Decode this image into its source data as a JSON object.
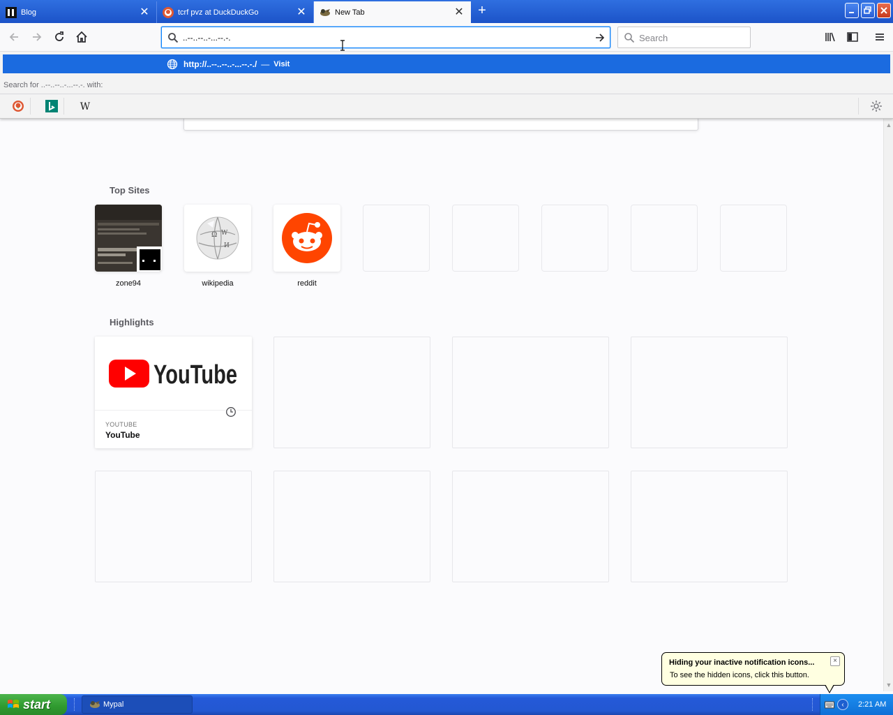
{
  "tabs": [
    {
      "label": "Blog",
      "favicon": "blog-favicon",
      "active": false
    },
    {
      "label": "tcrf pvz at DuckDuckGo",
      "favicon": "duckduckgo-favicon",
      "active": false
    },
    {
      "label": "New Tab",
      "favicon": "mypal-favicon",
      "active": true
    }
  ],
  "urlbar": {
    "value": "..--..--..-...--.-."
  },
  "searchbar": {
    "placeholder": "Search"
  },
  "dropdown": {
    "suggestion_url": "http://..--..--..-...--.-./",
    "suggestion_dash": "—",
    "suggestion_action": "Visit",
    "search_for": "Search for ..--..--..-...--.-. with:",
    "engines": [
      "duckduckgo-icon",
      "bing-icon",
      "wikipedia-w-icon"
    ]
  },
  "top_sites": {
    "title": "Top Sites",
    "sites": [
      {
        "label": "zone94"
      },
      {
        "label": "wikipedia"
      },
      {
        "label": "reddit"
      }
    ]
  },
  "highlights": {
    "title": "Highlights",
    "card": {
      "host": "YOUTUBE",
      "title": "YouTube",
      "logo_text": "YouTube"
    }
  },
  "notification": {
    "title": "Hiding your inactive notification icons...",
    "text": "To see the hidden icons, click this button.",
    "close": "×"
  },
  "taskbar": {
    "start_label": "start",
    "app_label": "Mypal",
    "clock": "2:21 AM"
  },
  "colors": {
    "tab_strip": "#1c53c8",
    "suggestion_highlight": "#1b6be0",
    "reddit": "#ff4500",
    "youtube_red": "#ff0000",
    "start_green": "#2f9a2f",
    "balloon": "#ffffe1"
  }
}
